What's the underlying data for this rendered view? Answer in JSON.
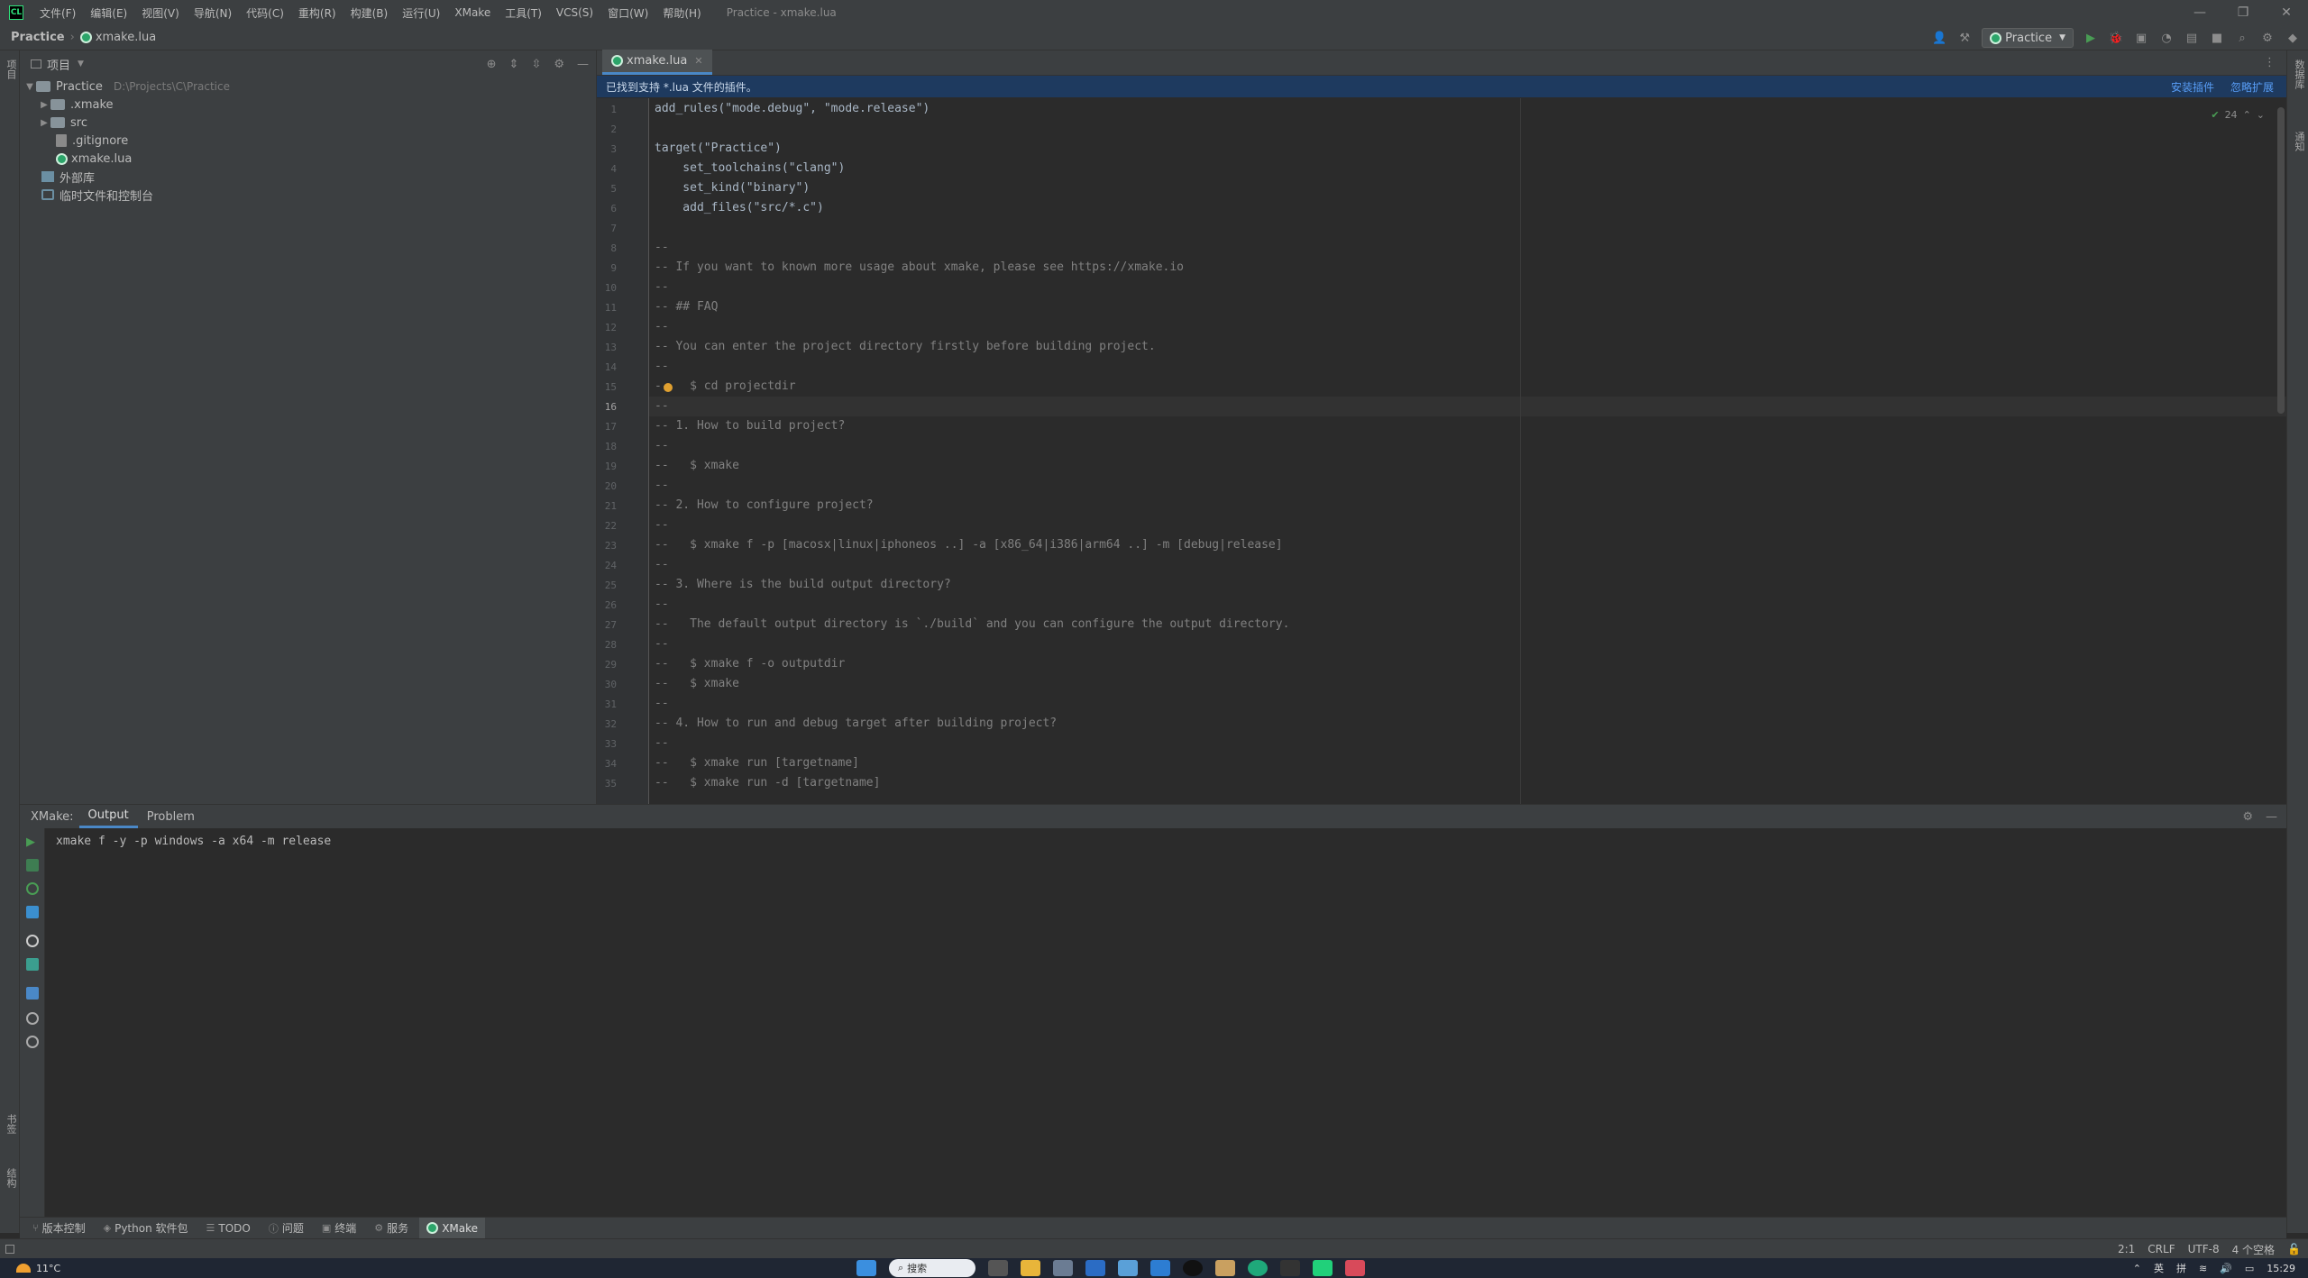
{
  "menubar": {
    "items": [
      "文件(F)",
      "编辑(E)",
      "视图(V)",
      "导航(N)",
      "代码(C)",
      "重构(R)",
      "构建(B)",
      "运行(U)",
      "XMake",
      "工具(T)",
      "VCS(S)",
      "窗口(W)",
      "帮助(H)"
    ],
    "window_title": "Practice - xmake.lua"
  },
  "navbar": {
    "project": "Practice",
    "file": "xmake.lua",
    "run_config": "Practice"
  },
  "project_panel": {
    "title": "项目",
    "root": {
      "name": "Practice",
      "path": "D:\\Projects\\C\\Practice"
    },
    "items": [
      {
        "name": ".xmake",
        "type": "folder"
      },
      {
        "name": "src",
        "type": "folder"
      },
      {
        "name": ".gitignore",
        "type": "file"
      },
      {
        "name": "xmake.lua",
        "type": "lua"
      }
    ],
    "external_libs": "外部库",
    "scratches": "临时文件和控制台"
  },
  "editor": {
    "tab": "xmake.lua",
    "notification": "已找到支持 *.lua 文件的插件。",
    "notification_actions": [
      "安装插件",
      "忽略扩展"
    ],
    "inspection_count": "24",
    "current_line": 16,
    "lines": [
      "add_rules(\"mode.debug\", \"mode.release\")",
      "",
      "target(\"Practice\")",
      "    set_toolchains(\"clang\")",
      "    set_kind(\"binary\")",
      "    add_files(\"src/*.c\")",
      "",
      "--",
      "-- If you want to known more usage about xmake, please see https://xmake.io",
      "--",
      "-- ## FAQ",
      "--",
      "-- You can enter the project directory firstly before building project.",
      "--",
      "--   $ cd projectdir",
      "--",
      "-- 1. How to build project?",
      "--",
      "--   $ xmake",
      "--",
      "-- 2. How to configure project?",
      "--",
      "--   $ xmake f -p [macosx|linux|iphoneos ..] -a [x86_64|i386|arm64 ..] -m [debug|release]",
      "--",
      "-- 3. Where is the build output directory?",
      "--",
      "--   The default output directory is `./build` and you can configure the output directory.",
      "--",
      "--   $ xmake f -o outputdir",
      "--   $ xmake",
      "--",
      "-- 4. How to run and debug target after building project?",
      "--",
      "--   $ xmake run [targetname]",
      "--   $ xmake run -d [targetname]"
    ]
  },
  "toolwindow": {
    "label": "XMake:",
    "tabs": [
      "Output",
      "Problem"
    ],
    "output": "xmake f -y -p windows -a x64 -m release"
  },
  "tooltabs": [
    "版本控制",
    "Python 软件包",
    "TODO",
    "问题",
    "终端",
    "服务",
    "XMake"
  ],
  "statusbar": {
    "position": "2:1",
    "line_ending": "CRLF",
    "encoding": "UTF-8",
    "indent": "4 个空格"
  },
  "taskbar": {
    "weather": "11°C",
    "search": "搜索",
    "ime1": "英",
    "ime2": "拼",
    "time": "15:29"
  },
  "leftstrip": {
    "top": "项目",
    "bottom1": "书签",
    "bottom2": "结构"
  },
  "rightstrip": {
    "top": "数据库",
    "bottom": "通知"
  },
  "colors": {
    "accent": "#4a88c7",
    "notification_bg": "#1e3a5f",
    "run_green": "#499c54"
  }
}
